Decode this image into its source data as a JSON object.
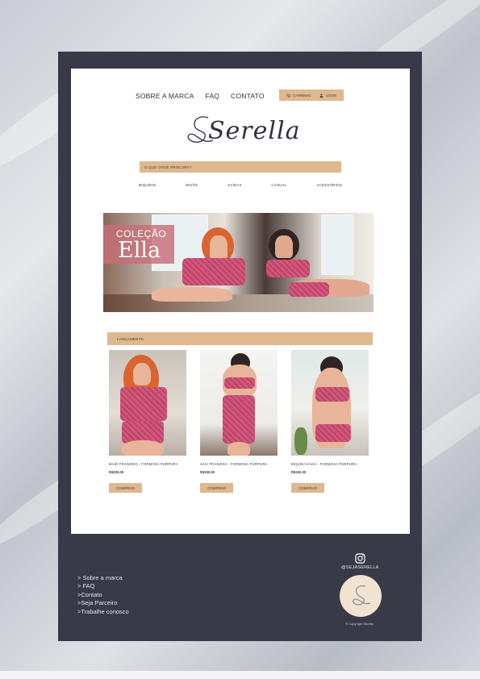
{
  "nav": {
    "items": [
      "SOBRE A MARCA",
      "FAQ",
      "CONTATO"
    ],
    "cart_label": "CARRINHO",
    "login_label": "LOGIN"
  },
  "brand": {
    "logo_text": "Serella"
  },
  "search": {
    "placeholder": "O QUE VOCÊ PROCURA?"
  },
  "categories": [
    "BIQUÍNIS",
    "MAIÔS",
    "SAÍDAS",
    "CASUAL",
    "ACESSÓRIOS"
  ],
  "banner": {
    "line1": "COLEÇÃO",
    "line2": "Ella"
  },
  "section": {
    "title": "LANÇAMENTO"
  },
  "products": [
    {
      "name": "MAIÔ FRANZIDO - FORMOSA PÚRPURA",
      "price": "R$200,00",
      "button": "COMPRAR"
    },
    {
      "name": "SAIA FRANZIDA - FORMOSA PÚRPURA",
      "price": "R$150,00",
      "button": "COMPRAR"
    },
    {
      "name": "BIQUÍNI HAVAÍ - FORMOSA PÚRPURA",
      "price": "R$150,00",
      "button": "COMPRAR"
    }
  ],
  "footer": {
    "links": [
      "> Sobre a marca",
      "> FAQ",
      ">Contato",
      ">Seja Parceiro",
      ">Trabalhe conosco"
    ],
    "instagram_handle": "@SEJASERELLA",
    "copyright": "© Copyright Serella"
  },
  "colors": {
    "accent": "#dfb88e",
    "frame": "#383a48",
    "swimwear": "#d4557a"
  }
}
